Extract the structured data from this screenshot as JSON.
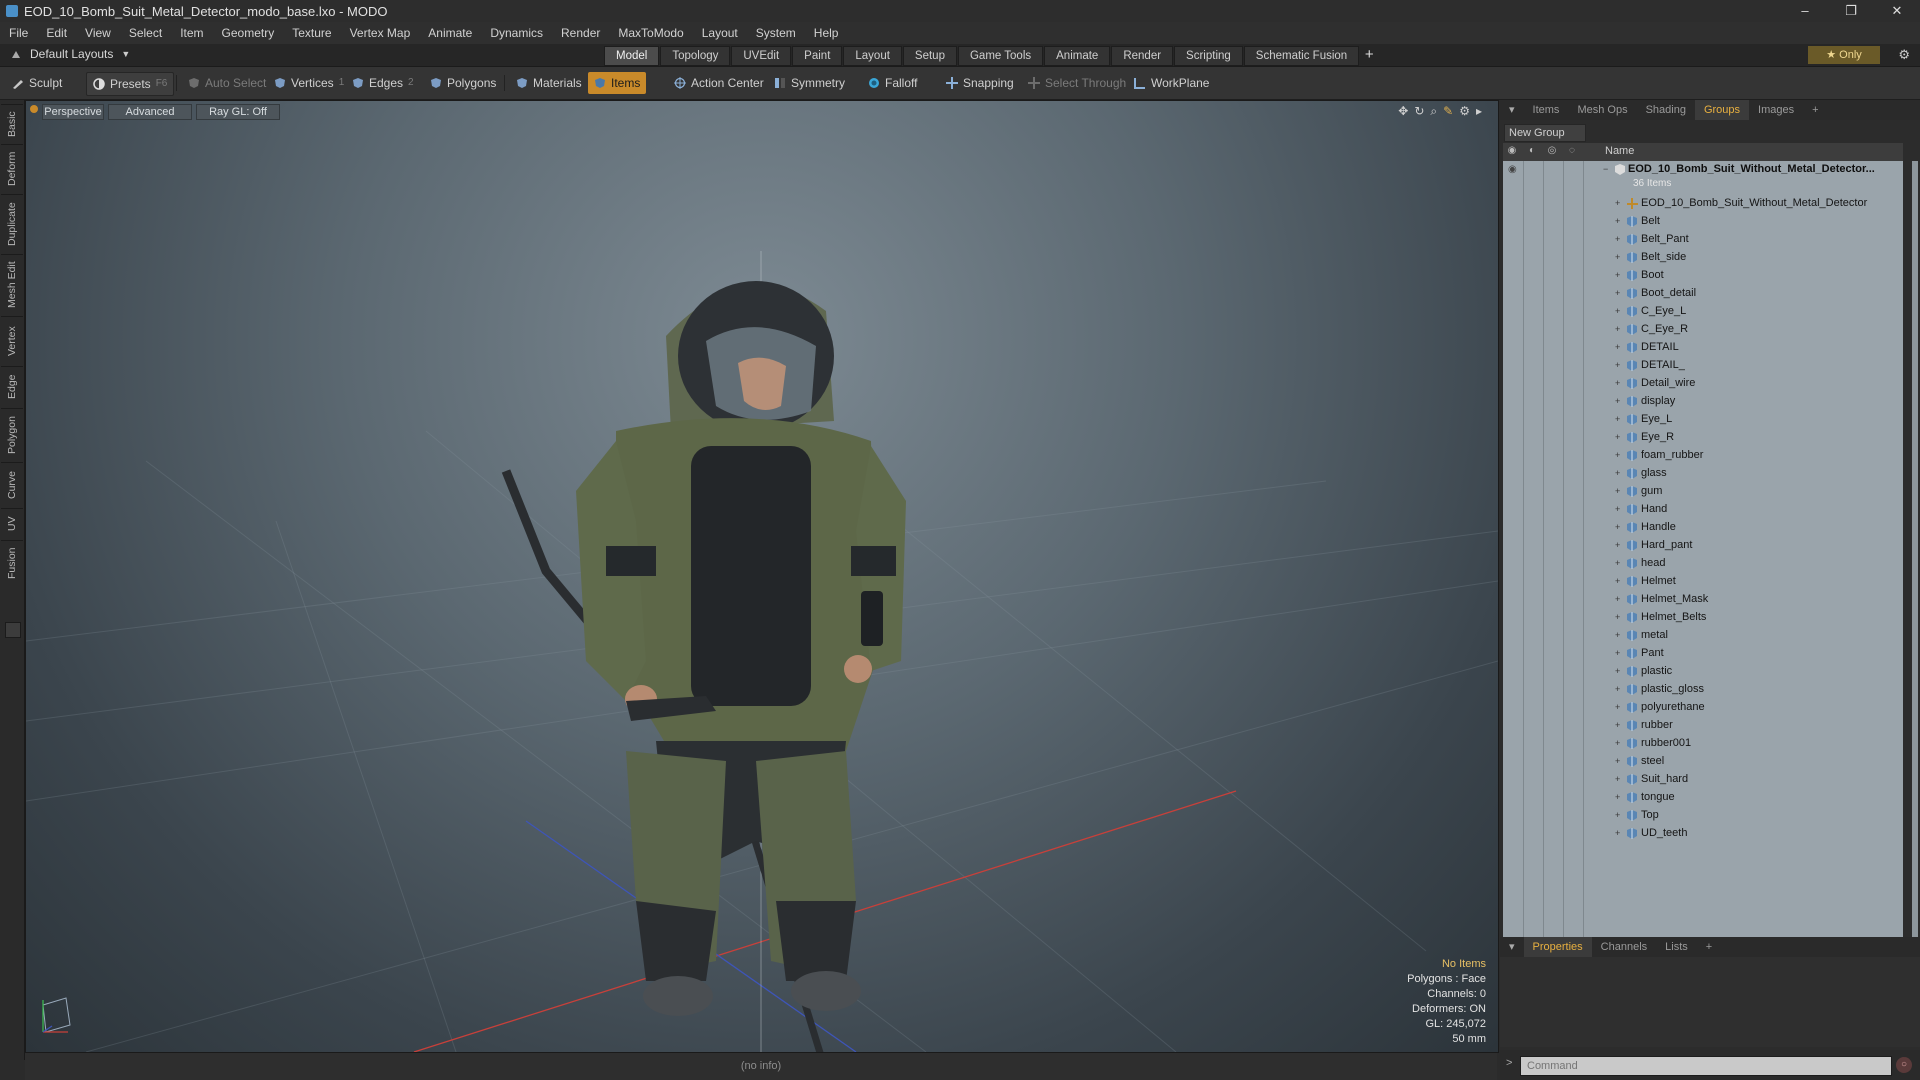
{
  "window": {
    "title": "EOD_10_Bomb_Suit_Metal_Detector_modo_base.lxo - MODO",
    "minimize": "–",
    "restore": "❐",
    "close": "✕"
  },
  "menu": [
    "File",
    "Edit",
    "View",
    "Select",
    "Item",
    "Geometry",
    "Texture",
    "Vertex Map",
    "Animate",
    "Dynamics",
    "Render",
    "MaxToModo",
    "Layout",
    "System",
    "Help"
  ],
  "layout": {
    "preset": "Default Layouts",
    "tabs": [
      "Model",
      "Topology",
      "UVEdit",
      "Paint",
      "Layout",
      "Setup",
      "Game Tools",
      "Animate",
      "Render",
      "Scripting",
      "Schematic Fusion"
    ],
    "active_tab": "Model",
    "plus": "+",
    "only_label": "Only"
  },
  "toolbar": {
    "sculpt": "Sculpt",
    "presets": "Presets",
    "presets_key": "F6",
    "auto_select": "Auto Select",
    "vertices": "Vertices",
    "vertices_key": "1",
    "edges": "Edges",
    "edges_key": "2",
    "polygons": "Polygons",
    "materials": "Materials",
    "items": "Items",
    "action_center": "Action Center",
    "symmetry": "Symmetry",
    "falloff": "Falloff",
    "snapping": "Snapping",
    "select_through": "Select Through",
    "workplane": "WorkPlane"
  },
  "left_tabs": [
    "Basic",
    "Deform",
    "Duplicate",
    "Mesh Edit",
    "Vertex",
    "Edge",
    "Polygon",
    "Curve",
    "UV",
    "Fusion"
  ],
  "viewport": {
    "view": "Perspective",
    "mode": "Advanced",
    "raygl": "Ray GL: Off",
    "stats": {
      "selection": "No Items",
      "polygons": "Polygons : Face",
      "channels": "Channels: 0",
      "deformers": "Deformers: ON",
      "gl": "GL: 245,072",
      "focal": "50 mm"
    }
  },
  "status": "(no info)",
  "right_panel": {
    "tabs": [
      "Items",
      "Mesh Ops",
      "Shading",
      "Groups",
      "Images"
    ],
    "active_tab": "Groups",
    "plus": "+",
    "new_group": "New Group",
    "name_header": "Name",
    "root": {
      "label": "EOD_10_Bomb_Suit_Without_Metal_Detector...",
      "count": "36 Items"
    },
    "items": [
      "EOD_10_Bomb_Suit_Without_Metal_Detector",
      "Belt",
      "Belt_Pant",
      "Belt_side",
      "Boot",
      "Boot_detail",
      "C_Eye_L",
      "C_Eye_R",
      "DETAIL",
      "DETAIL_",
      "Detail_wire",
      "display",
      "Eye_L",
      "Eye_R",
      "foam_rubber",
      "glass",
      "gum",
      "Hand",
      "Handle",
      "Hard_pant",
      "head",
      "Helmet",
      "Helmet_Mask",
      "Helmet_Belts",
      "metal",
      "Pant",
      "plastic",
      "plastic_gloss",
      "polyurethane",
      "rubber",
      "rubber001",
      "steel",
      "Suit_hard",
      "tongue",
      "Top",
      "UD_teeth"
    ],
    "prop_tabs": [
      "Properties",
      "Channels",
      "Lists"
    ],
    "prop_active": "Properties",
    "command_placeholder": "Command",
    "command_prompt": ">"
  },
  "colors": {
    "accent": "#c98a2a",
    "active_tab_text": "#e8b040",
    "list_bg": "#9aa4ab"
  }
}
